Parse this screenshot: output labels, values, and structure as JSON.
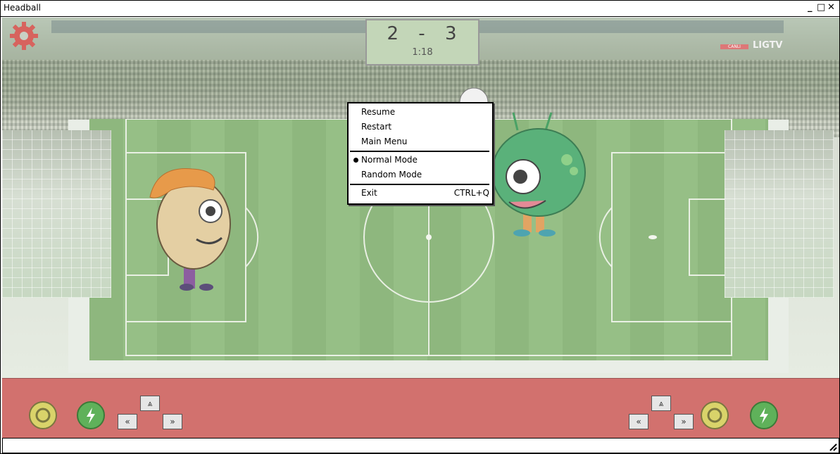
{
  "window": {
    "title": "Headball",
    "controls": {
      "minimize": "_",
      "maximize": "□",
      "close": "✕"
    }
  },
  "scoreboard": {
    "score_left": "2",
    "dash": "-",
    "score_right": "3",
    "time": "1:18"
  },
  "broadcast": {
    "live_label": "CANLI",
    "channel": "LIGTV"
  },
  "menu": {
    "items": [
      {
        "label": "Resume"
      },
      {
        "label": "Restart"
      },
      {
        "label": "Main Menu"
      },
      {
        "label": "Normal Mode",
        "selected": true
      },
      {
        "label": "Random Mode",
        "selected": false
      },
      {
        "label": "Exit",
        "shortcut": "CTRL+Q"
      }
    ]
  },
  "controls": {
    "left": {
      "fire_icon": "fire-icon",
      "power_icon": "lightning-icon",
      "up": "⩓",
      "left": "«",
      "right": "»"
    },
    "right": {
      "fire_icon": "fire-icon",
      "power_icon": "lightning-icon",
      "up": "⩓",
      "left": "«",
      "right": "»"
    }
  },
  "colors": {
    "panel": "#d2716e",
    "grass": "#8eb77e",
    "scoreboard": "#c3d6b8",
    "gear": "#d7635e"
  }
}
